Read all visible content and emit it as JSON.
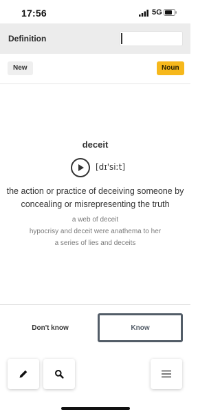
{
  "status": {
    "time": "17:56",
    "network": "5G"
  },
  "header": {
    "title": "Definition",
    "search": {
      "value": "",
      "placeholder": ""
    }
  },
  "tags": {
    "state": "New",
    "part_of_speech": "Noun"
  },
  "card": {
    "word": "deceit",
    "pronunciation": "[dɪ'siːt]",
    "definition": "the action or practice of deceiving someone by concealing or misrepresenting the truth",
    "examples": [
      "a web of deceit",
      "hypocrisy and deceit were anathema to her",
      "a series of lies and deceits"
    ]
  },
  "answers": {
    "dont_know": "Don't know",
    "know": "Know"
  },
  "toolbar": {
    "icons": [
      "pencil-icon",
      "search-icon",
      "hamburger-menu-icon"
    ]
  },
  "colors": {
    "accent": "#f6b81c",
    "know_border": "#535d68",
    "header_bg": "#ececec"
  }
}
